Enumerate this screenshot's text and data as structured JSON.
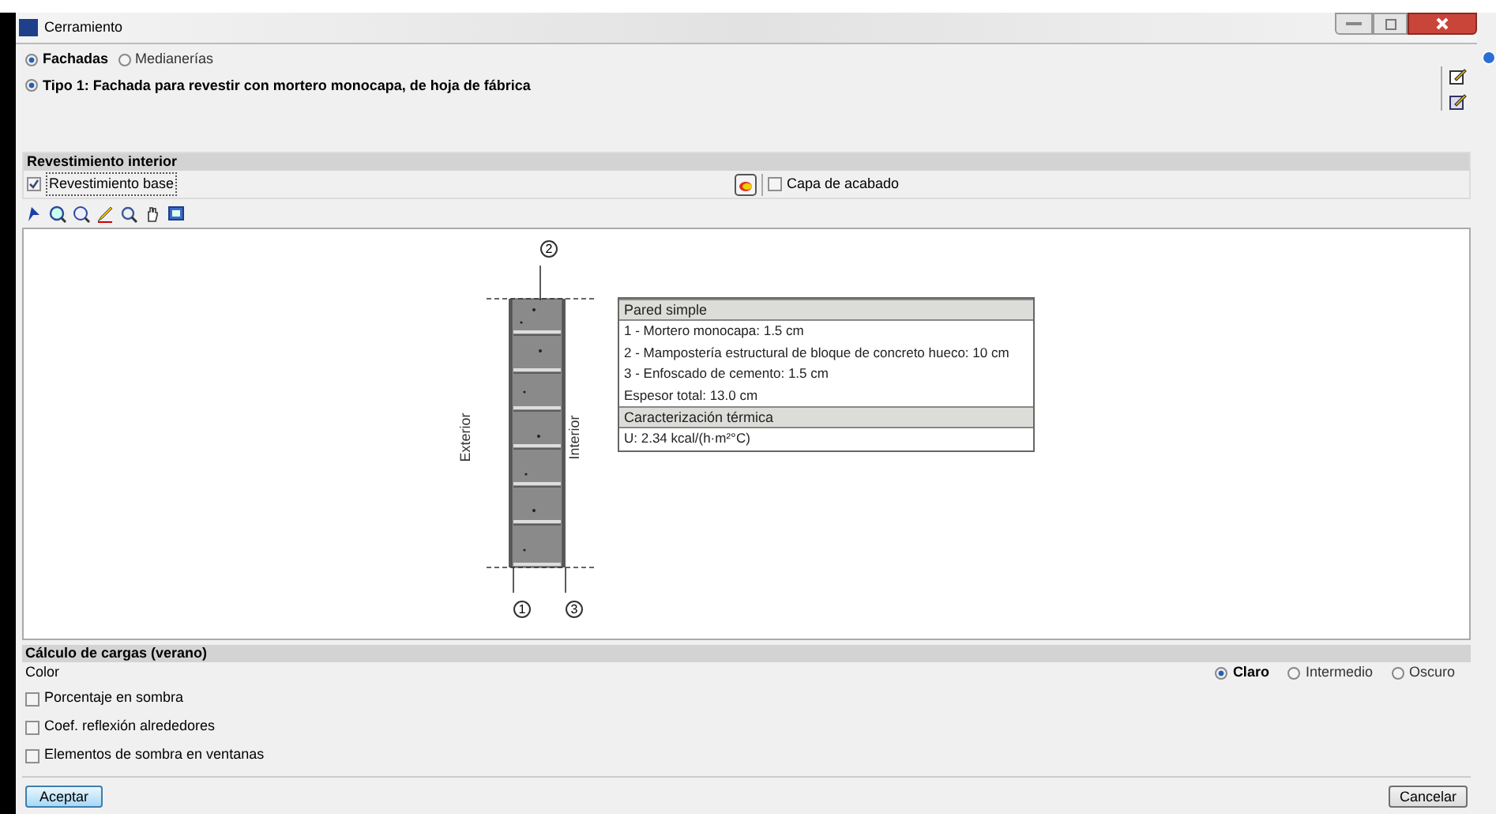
{
  "window": {
    "title": "Cerramiento"
  },
  "mode_options": [
    {
      "label": "Fachadas",
      "selected": true
    },
    {
      "label": "Medianerías",
      "selected": false
    }
  ],
  "types": [
    {
      "label": "Tipo 1: Fachada para revestir con mortero monocapa, de hoja de fábrica",
      "selected": true
    }
  ],
  "interior_lining": {
    "title": "Revestimiento interior",
    "base": {
      "label": "Revestimiento base",
      "checked": true
    },
    "finish": {
      "label": "Capa de acabado",
      "checked": false
    }
  },
  "diagram": {
    "callouts": [
      "2",
      "1",
      "3"
    ],
    "side_labels": [
      "Exterior",
      "Interior"
    ],
    "table": [
      {
        "kind": "header",
        "text": "Pared simple"
      },
      {
        "kind": "row",
        "text": "1 - Mortero monocapa: 1.5 cm"
      },
      {
        "kind": "row",
        "text": "2 - Mampostería estructural de bloque de concreto hueco: 10 cm"
      },
      {
        "kind": "row",
        "text": "3 - Enfoscado de cemento: 1.5 cm"
      },
      {
        "kind": "row",
        "text": "Espesor total: 13.0 cm"
      },
      {
        "kind": "header",
        "text": "Caracterización térmica"
      },
      {
        "kind": "row",
        "text": "U: 2.34 kcal/(h·m²°C)"
      }
    ]
  },
  "loads": {
    "title": "Cálculo de cargas (verano)",
    "color_label": "Color",
    "color_options": [
      {
        "label": "Claro",
        "selected": true
      },
      {
        "label": "Intermedio",
        "selected": false
      },
      {
        "label": "Oscuro",
        "selected": false
      }
    ],
    "options": [
      {
        "label": "Porcentaje en sombra",
        "checked": false
      },
      {
        "label": "Coef. reflexión alrededores",
        "checked": false
      },
      {
        "label": "Elementos de sombra en ventanas",
        "checked": false
      }
    ]
  },
  "buttons": {
    "ok": "Aceptar",
    "cancel": "Cancelar"
  }
}
